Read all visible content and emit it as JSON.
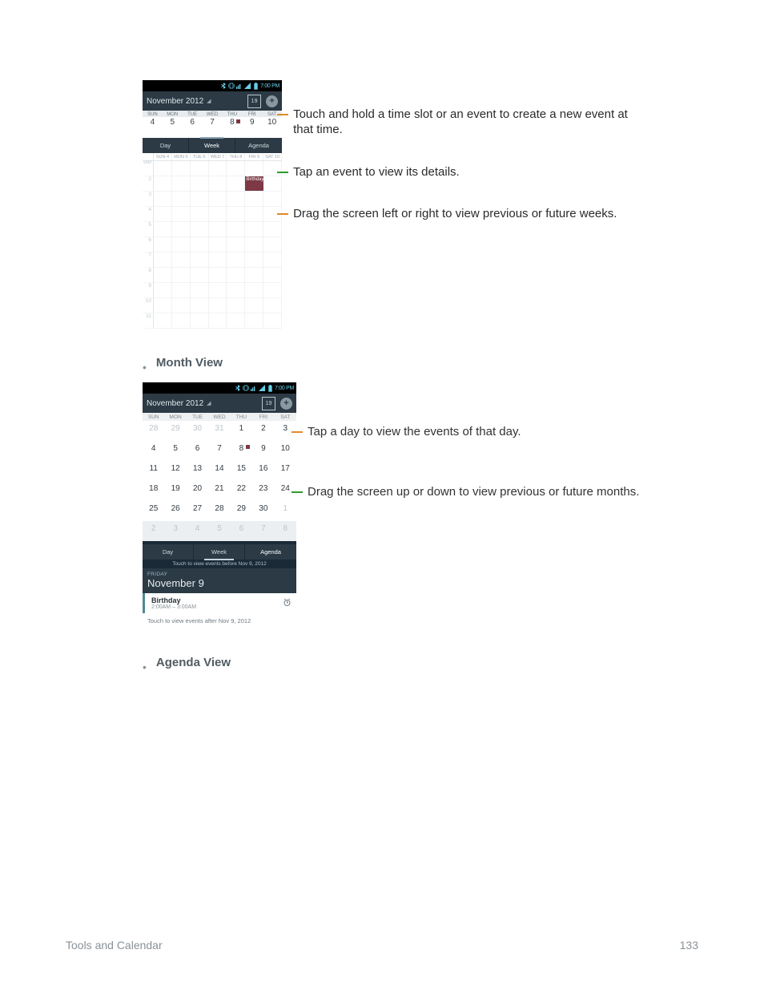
{
  "status": {
    "time": "7:00 PM"
  },
  "titlebar": {
    "title": "November 2012",
    "today_num": "19"
  },
  "week": {
    "day_labels": [
      "SUN",
      "MON",
      "TUE",
      "WED",
      "THU",
      "FRI",
      "SAT"
    ],
    "day_nums": [
      "4",
      "5",
      "6",
      "7",
      "8",
      "9",
      "10"
    ],
    "tabs": {
      "day": "Day",
      "week": "Week",
      "agenda": "Agenda"
    },
    "grid_labels": [
      "SUN 4",
      "MON 5",
      "TUE 6",
      "WED 7",
      "THU 8",
      "FRI 9",
      "SAT 10"
    ],
    "hours": [
      "1",
      "2",
      "3",
      "4",
      "5",
      "6",
      "7",
      "8",
      "9",
      "10",
      "11"
    ],
    "event_label": "Birthday"
  },
  "week_annotations": {
    "a1": "Touch and hold a time slot or an event to create a new event at that time.",
    "a2": "Tap an event to view its details.",
    "a3": "Drag the screen left or right to view previous or future weeks."
  },
  "section_month": "Month View",
  "month": {
    "hdr": [
      "SUN",
      "MON",
      "TUE",
      "WED",
      "THU",
      "FRI",
      "SAT"
    ],
    "cells": [
      {
        "v": "28",
        "dim": true
      },
      {
        "v": "29",
        "dim": true
      },
      {
        "v": "30",
        "dim": true
      },
      {
        "v": "31",
        "dim": true
      },
      {
        "v": "1"
      },
      {
        "v": "2"
      },
      {
        "v": "3"
      },
      {
        "v": "4"
      },
      {
        "v": "5"
      },
      {
        "v": "6"
      },
      {
        "v": "7"
      },
      {
        "v": "8",
        "mark": true
      },
      {
        "v": "9"
      },
      {
        "v": "10"
      },
      {
        "v": "11"
      },
      {
        "v": "12"
      },
      {
        "v": "13"
      },
      {
        "v": "14"
      },
      {
        "v": "15"
      },
      {
        "v": "16"
      },
      {
        "v": "17"
      },
      {
        "v": "18"
      },
      {
        "v": "19"
      },
      {
        "v": "20"
      },
      {
        "v": "21"
      },
      {
        "v": "22"
      },
      {
        "v": "23"
      },
      {
        "v": "24"
      },
      {
        "v": "25"
      },
      {
        "v": "26"
      },
      {
        "v": "27"
      },
      {
        "v": "28"
      },
      {
        "v": "29"
      },
      {
        "v": "30"
      },
      {
        "v": "1",
        "dim": true
      },
      {
        "v": "2",
        "dim": true,
        "fade": true
      },
      {
        "v": "3",
        "dim": true,
        "fade": true
      },
      {
        "v": "4",
        "dim": true,
        "fade": true
      },
      {
        "v": "5",
        "dim": true,
        "fade": true
      },
      {
        "v": "6",
        "dim": true,
        "fade": true
      },
      {
        "v": "7",
        "dim": true,
        "fade": true
      },
      {
        "v": "8",
        "dim": true,
        "fade": true
      }
    ],
    "touch_before": "Touch to view events before Nov 9, 2012",
    "day_header_dow": "FRIDAY",
    "day_header_date": "November 9",
    "event_title": "Birthday",
    "event_time": "2:00AM – 3:00AM",
    "touch_after": "Touch to view events after Nov 9, 2012"
  },
  "month_annotations": {
    "a1": "Tap a day to view the events of that day.",
    "a2": "Drag the screen up or down to view previous or future months."
  },
  "section_agenda": "Agenda View",
  "footer": {
    "left": "Tools and Calendar",
    "right": "133"
  }
}
